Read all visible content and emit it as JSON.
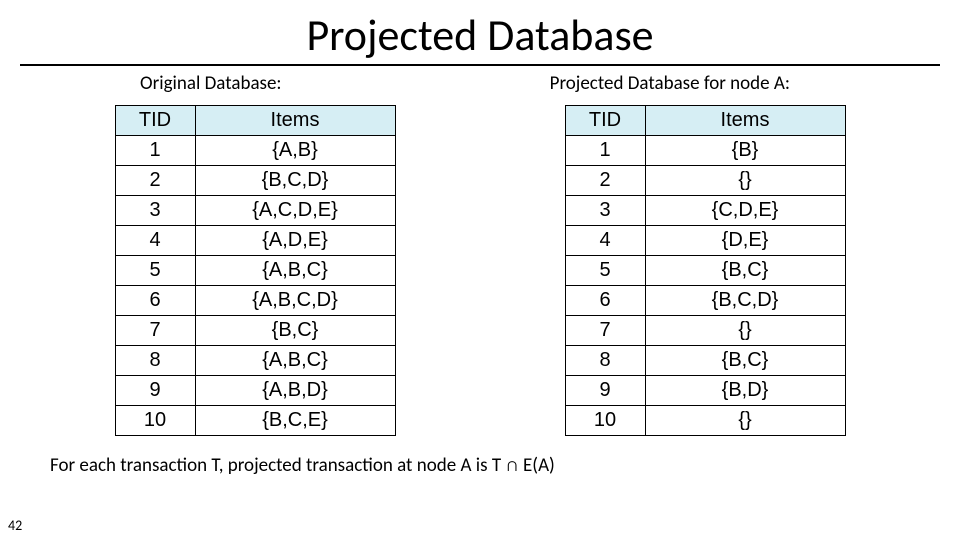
{
  "title": "Projected Database",
  "left_label": "Original Database:",
  "right_label": "Projected Database for node A:",
  "header_tid": "TID",
  "header_items": "Items",
  "original_rows": [
    {
      "tid": "1",
      "items": "{A,B}"
    },
    {
      "tid": "2",
      "items": "{B,C,D}"
    },
    {
      "tid": "3",
      "items": "{A,C,D,E}"
    },
    {
      "tid": "4",
      "items": "{A,D,E}"
    },
    {
      "tid": "5",
      "items": "{A,B,C}"
    },
    {
      "tid": "6",
      "items": "{A,B,C,D}"
    },
    {
      "tid": "7",
      "items": "{B,C}"
    },
    {
      "tid": "8",
      "items": "{A,B,C}"
    },
    {
      "tid": "9",
      "items": "{A,B,D}"
    },
    {
      "tid": "10",
      "items": "{B,C,E}"
    }
  ],
  "projected_rows": [
    {
      "tid": "1",
      "items": "{B}"
    },
    {
      "tid": "2",
      "items": "{}"
    },
    {
      "tid": "3",
      "items": "{C,D,E}"
    },
    {
      "tid": "4",
      "items": "{D,E}"
    },
    {
      "tid": "5",
      "items": "{B,C}"
    },
    {
      "tid": "6",
      "items": "{B,C,D}"
    },
    {
      "tid": "7",
      "items": "{}"
    },
    {
      "tid": "8",
      "items": "{B,C}"
    },
    {
      "tid": "9",
      "items": "{B,D}"
    },
    {
      "tid": "10",
      "items": "{}"
    }
  ],
  "footer_pre": "For each transaction T, projected transaction at node A is T ",
  "footer_post": " E(A)",
  "intersect_symbol": "∩",
  "page_number": "42"
}
